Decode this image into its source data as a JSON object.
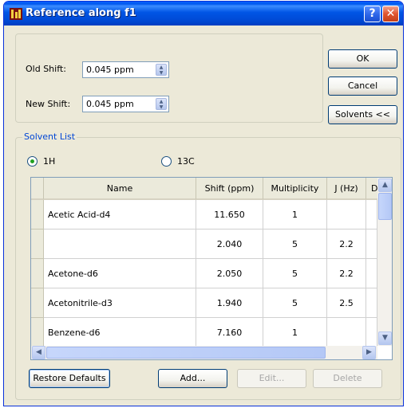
{
  "window": {
    "title": "Reference along f1"
  },
  "titlebar": {
    "help_glyph": "?",
    "close_glyph": "✕"
  },
  "shift": {
    "old_label": "Old Shift:",
    "old_value": "0.045 ppm",
    "new_label": "New Shift:",
    "new_value": "0.045 ppm"
  },
  "buttons": {
    "ok": "OK",
    "cancel": "Cancel",
    "solvents": "Solvents <<",
    "restore": "Restore Defaults",
    "add": "Add...",
    "edit": "Edit...",
    "delete": "Delete"
  },
  "solvent_list": {
    "title": "Solvent List",
    "nuclei": [
      {
        "label": "1H",
        "selected": true
      },
      {
        "label": "13C",
        "selected": false
      }
    ],
    "columns": [
      "Name",
      "Shift (ppm)",
      "Multiplicity",
      "J (Hz)",
      "Desc"
    ],
    "rows": [
      {
        "name": "Acetic Acid-d4",
        "shift": "11.650",
        "mult": "1",
        "j": ""
      },
      {
        "name": "",
        "shift": "2.040",
        "mult": "5",
        "j": "2.2"
      },
      {
        "name": "Acetone-d6",
        "shift": "2.050",
        "mult": "5",
        "j": "2.2"
      },
      {
        "name": "Acetonitrile-d3",
        "shift": "1.940",
        "mult": "5",
        "j": "2.5"
      },
      {
        "name": "Benzene-d6",
        "shift": "7.160",
        "mult": "1",
        "j": ""
      }
    ]
  },
  "icons": [
    "app-icon",
    "help-icon",
    "close-icon",
    "spin-arrows-icon",
    "scroll-up-icon",
    "scroll-down-icon",
    "scroll-left-icon",
    "scroll-right-icon"
  ],
  "colors": {
    "titlebar": "#0058ee",
    "dialog_bg": "#ece9d8",
    "group_title": "#0046d5"
  }
}
